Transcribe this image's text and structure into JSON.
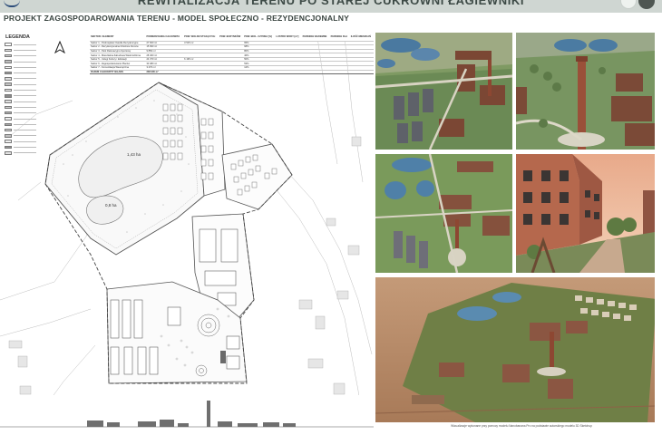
{
  "header": {
    "title": "REWITALIZACJA TERENU PO STAREJ CUKROWNI ŁAGIEWNIKI",
    "subtitle": "PROJEKT ZAGOSPODAROWANIA TERENU - MODEL SPOŁECZNO - REZYDENCJONALNY"
  },
  "legend": {
    "title": "LEGENDA",
    "swatch_colors": [
      "#ffffff",
      "#e7e7e7",
      "#d2d2d2",
      "#bdbdbd",
      "#f2f2f2",
      "#9c9c9c",
      "#dedede",
      "#c4c4c4",
      "#f7f7f7",
      "#8a8a8a",
      "#e0e0e0",
      "#cfcfcf",
      "#b0b0b0",
      "#ededed",
      "#a9a9a9",
      "#d9d9d9",
      "#c0c0c0",
      "#efefef",
      "#969696",
      "#e4e4e4"
    ]
  },
  "table": {
    "headers": [
      "SEKTOR / ELEMENT",
      "POWIERZCHNIA CAŁKOWITA",
      "POW. WOLNO STOJĄCYCH",
      "POW. BUDYNKÓW",
      "POW. BIOL. CZYNNA [%]",
      "LUSTRO WODY [m²]",
      "PARKINGI NAZIEMNE",
      "PARKINGI DLA",
      "ILOŚĆ MIESZKAŃ"
    ],
    "rows": [
      [
        "Sektor 1 - Podmiejskie Osiedle Rezydencyjne",
        "27 660 m²",
        "3 515 m²",
        "",
        "65%",
        "",
        "",
        "",
        ""
      ],
      [
        "Sektor 2 - Rezydencjonalna Dzielnica Domów",
        "15 990 m²",
        "",
        "",
        "68%",
        "",
        "",
        "",
        ""
      ],
      [
        "Sektor 3 - Park Rekreacyjno-Sportowy",
        "9 850 m²",
        "",
        "",
        "80%",
        "",
        "",
        "",
        ""
      ],
      [
        "Sektor 4 - Mieszkalna Zabudowa Wielorodzinna",
        "28 460 m²",
        "",
        "",
        "46%",
        "",
        "",
        "",
        ""
      ],
      [
        "Sektor 5 - Usługi Kultury i Edukacji",
        "24 370 m²",
        "6 195 m²",
        "",
        "50%",
        "",
        "",
        "",
        ""
      ],
      [
        "Sektor 6 - Zagospodarowanie Placów",
        "30 480 m²",
        "",
        "",
        "53%",
        "",
        "",
        "",
        ""
      ],
      [
        "Sektor 7 - Komunikacja Wewnętrzna",
        "3 470 m²",
        "",
        "",
        "12%",
        "",
        "",
        "",
        ""
      ]
    ],
    "total": [
      "RAZEM CAŁKOWITY BILANS",
      "238 900 m²",
      "",
      "",
      "",
      "",
      "",
      "",
      ""
    ]
  },
  "plan_labels": {
    "area_1": "1,43 ha",
    "area_2": "0,8 ha"
  },
  "renders": {
    "caption": "Wizualizacje wykonane przy pomocy modelu Nanobanana Pro na podstawie autorskiego modelu 3D Sketchup"
  }
}
